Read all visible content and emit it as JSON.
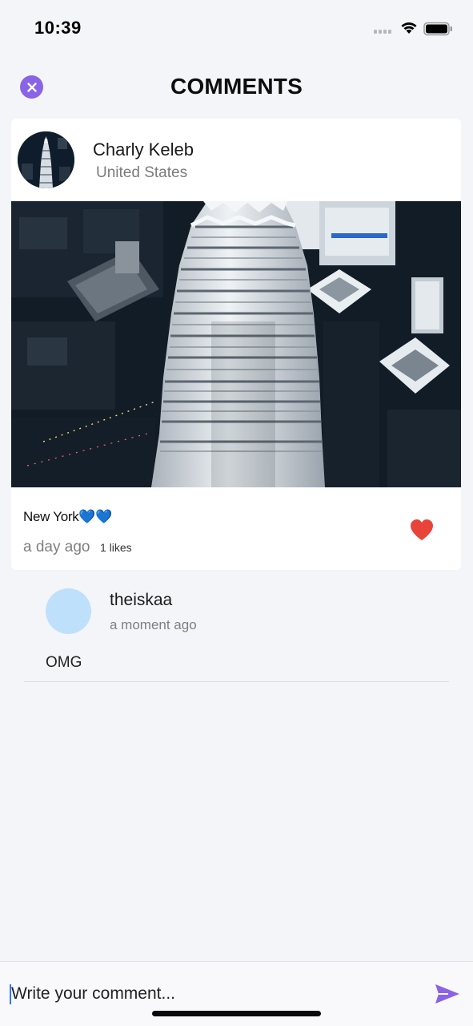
{
  "status_bar": {
    "time": "10:39",
    "icons": [
      "cellular-signal-icon",
      "wifi-icon",
      "battery-icon"
    ]
  },
  "header": {
    "title": "COMMENTS",
    "close_icon": "close-icon"
  },
  "post": {
    "author_name": "Charly Keleb",
    "author_location": "United States",
    "caption": "New York",
    "caption_emoji": "💙💙",
    "time_ago": "a day ago",
    "likes": "1 likes",
    "liked": true,
    "image_subject": "aerial-skyscraper-photo"
  },
  "comments": [
    {
      "username": "theiskaa",
      "time_ago": "a moment ago",
      "text": "OMG"
    }
  ],
  "composer": {
    "placeholder": "Write your comment...",
    "value": "",
    "send_icon": "send-icon"
  },
  "colors": {
    "accent": "#8a63e6",
    "like": "#e8443a",
    "background": "#f4f5f9",
    "card": "#ffffff",
    "comment_avatar": "#bfe0fb"
  }
}
